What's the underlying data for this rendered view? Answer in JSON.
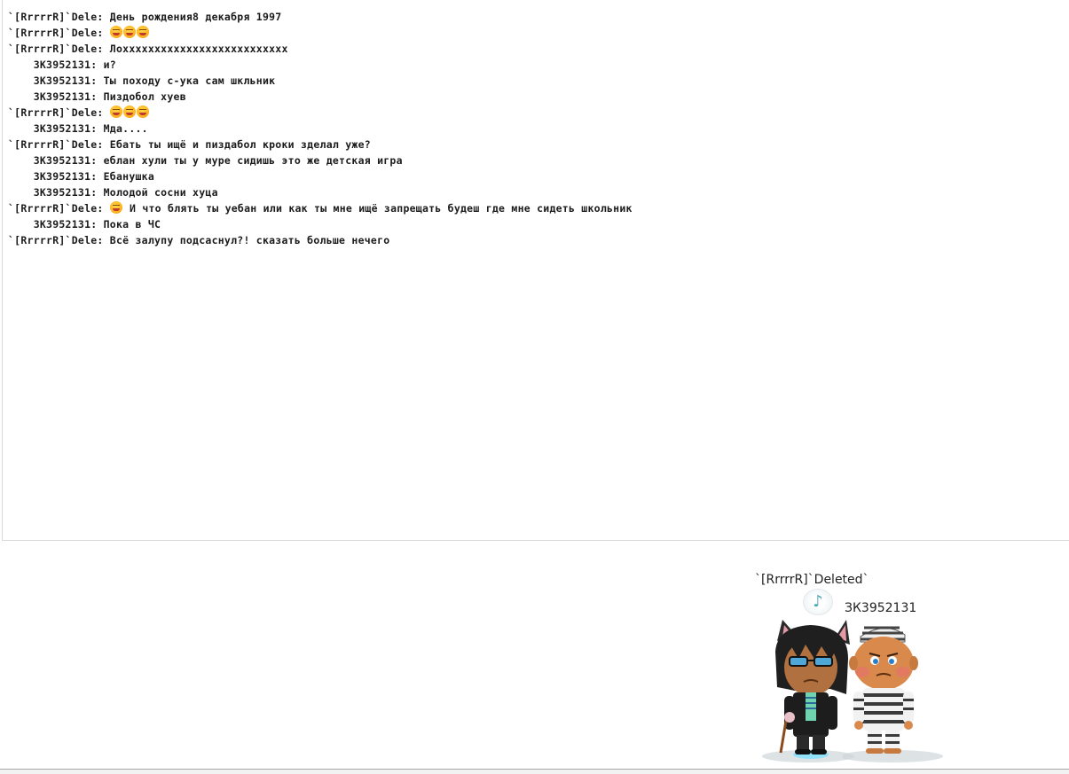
{
  "chat": {
    "messages": [
      {
        "sender": "`[RrrrrR]`Dele:",
        "emojis": 0,
        "text": "День рождения8 декабря 1997"
      },
      {
        "sender": "`[RrrrrR]`Dele:",
        "emojis": 3,
        "text": ""
      },
      {
        "sender": "`[RrrrrR]`Dele:",
        "emojis": 0,
        "text": "Лохххххххххххххххххххххххххх"
      },
      {
        "sender": "    ЗК3952131:",
        "emojis": 0,
        "text": "и?"
      },
      {
        "sender": "    ЗК3952131:",
        "emojis": 0,
        "text": "Ты походу с-ука сам шкльник"
      },
      {
        "sender": "    ЗК3952131:",
        "emojis": 0,
        "text": "Пиздобол хуев"
      },
      {
        "sender": "`[RrrrrR]`Dele:",
        "emojis": 3,
        "text": ""
      },
      {
        "sender": "    ЗК3952131:",
        "emojis": 0,
        "text": "Мда...."
      },
      {
        "sender": "`[RrrrrR]`Dele:",
        "emojis": 0,
        "text": "Ебать ты ищё и пиздабол кроки зделал уже?"
      },
      {
        "sender": "    ЗК3952131:",
        "emojis": 0,
        "text": "еблан хули ты у муре сидишь это же детская игра"
      },
      {
        "sender": "    ЗК3952131:",
        "emojis": 0,
        "text": "Ебанушка"
      },
      {
        "sender": "    ЗК3952131:",
        "emojis": 0,
        "text": "Молодой сосни хуца"
      },
      {
        "sender": "`[RrrrrR]`Dele:",
        "emojis": 1,
        "text": "И что блять ты уебан или как ты мне ищё запрещать будеш где мне сидеть школьник"
      },
      {
        "sender": "    ЗК3952131:",
        "emojis": 0,
        "text": "Пока в ЧС"
      },
      {
        "sender": "`[RrrrrR]`Dele:",
        "emojis": 0,
        "text": "Всё залупу подсаснул?! сказать больше нечего"
      }
    ]
  },
  "room": {
    "avatar_1_name": "`[RrrrrR]`Deleted`",
    "avatar_2_name": "ЗК3952131",
    "music_icon": "music-note-icon"
  },
  "colors": {
    "text": "#1b1b1b",
    "border": "#d8d8d8",
    "emoji": "#ffb41f"
  }
}
